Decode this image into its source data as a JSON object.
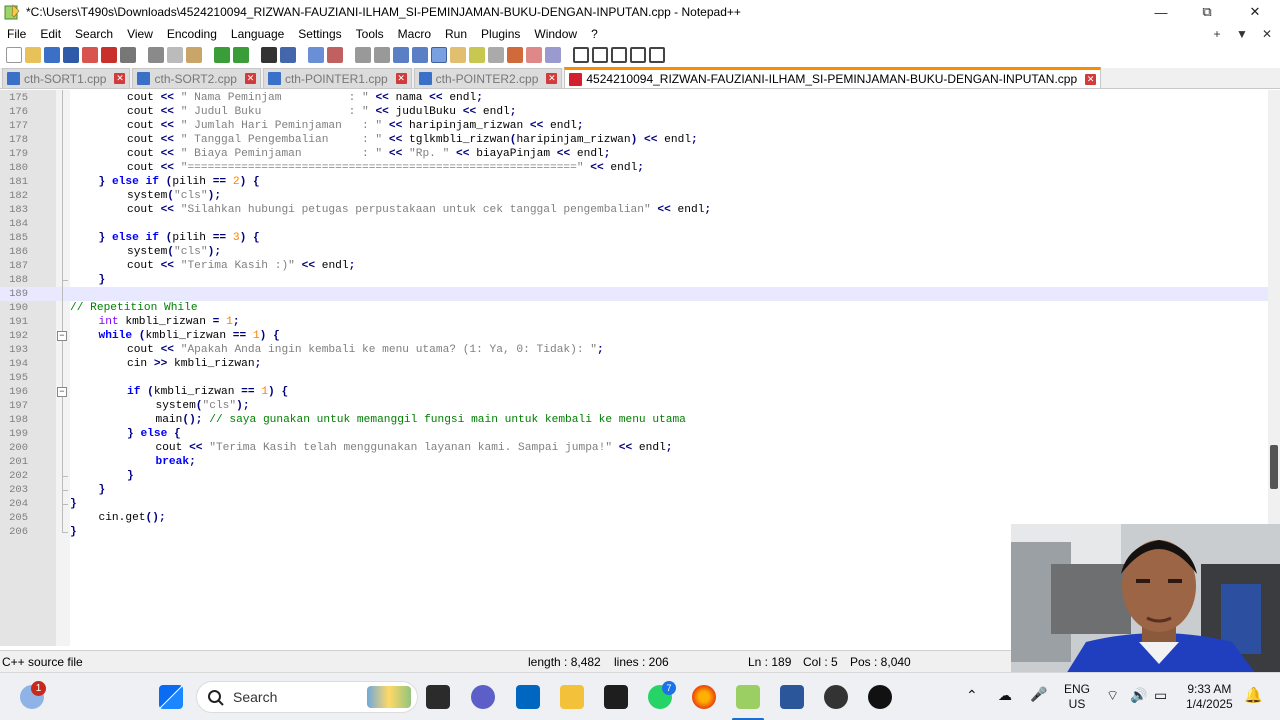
{
  "window": {
    "title": "*C:\\Users\\T490s\\Downloads\\4524210094_RIZWAN-FAUZIANI-ILHAM_SI-PEMINJAMAN-BUKU-DENGAN-INPUTAN.cpp - Notepad++",
    "app_icon": "notepadpp-icon",
    "controls": [
      "minimize-icon",
      "restore-icon",
      "close-icon"
    ]
  },
  "menu": {
    "items": [
      "File",
      "Edit",
      "Search",
      "View",
      "Encoding",
      "Language",
      "Settings",
      "Tools",
      "Macro",
      "Run",
      "Plugins",
      "Window",
      "?"
    ],
    "right_controls": [
      "+",
      "▼",
      "✕"
    ]
  },
  "toolbar": {
    "buttons": [
      "new-file-icon",
      "open-file-icon",
      "save-icon",
      "save-all-icon",
      "close-icon",
      "close-all-icon",
      "print-icon",
      "cut-icon",
      "copy-icon",
      "paste-icon",
      "undo-icon",
      "redo-icon",
      "find-icon",
      "replace-icon",
      "zoom-in-icon",
      "zoom-out-icon",
      "sync-vertical-icon",
      "sync-horizontal-icon",
      "word-wrap-icon",
      "show-all-chars-icon",
      "indent-guide-icon",
      "user-language-icon",
      "document-map-icon",
      "function-list-icon",
      "folder-workspace-icon",
      "monitoring-icon",
      "record-macro-icon",
      "stop-record-icon",
      "play-macro-icon",
      "run-macro-multiple-icon",
      "save-macro-icon"
    ]
  },
  "tabs": [
    {
      "label": "cth-SORT1.cpp",
      "active": false
    },
    {
      "label": "cth-SORT2.cpp",
      "active": false
    },
    {
      "label": "cth-POINTER1.cpp",
      "active": false
    },
    {
      "label": "cth-POINTER2.cpp",
      "active": false
    },
    {
      "label": "4524210094_RIZWAN-FAUZIANI-ILHAM_SI-PEMINJAMAN-BUKU-DENGAN-INPUTAN.cpp",
      "active": true
    }
  ],
  "editor": {
    "current_line": 189,
    "lines": [
      {
        "n": "175",
        "indent": 2,
        "code": "cout << \" Nama Peminjam          : \" << nama << endl;"
      },
      {
        "n": "176",
        "indent": 2,
        "code": "cout << \" Judul Buku             : \" << judulBuku << endl;"
      },
      {
        "n": "177",
        "indent": 2,
        "code": "cout << \" Jumlah Hari Peminjaman   : \" << haripinjam_rizwan << endl;"
      },
      {
        "n": "178",
        "indent": 2,
        "code": "cout << \" Tanggal Pengembalian     : \" << tglkmbli_rizwan(haripinjam_rizwan) << endl;"
      },
      {
        "n": "179",
        "indent": 2,
        "code": "cout << \" Biaya Peminjaman         : \" << \"Rp. \" << biayaPinjam << endl;"
      },
      {
        "n": "180",
        "indent": 2,
        "code": "cout << \"==========================================================\" << endl;"
      },
      {
        "n": "181",
        "indent": 1,
        "code": "} else if (pilih == 2) {"
      },
      {
        "n": "182",
        "indent": 2,
        "code": "system(\"cls\");"
      },
      {
        "n": "183",
        "indent": 2,
        "code": "cout << \"Silahkan hubungi petugas perpustakaan untuk cek tanggal pengembalian\" << endl;"
      },
      {
        "n": "184",
        "indent": 0,
        "code": ""
      },
      {
        "n": "185",
        "indent": 1,
        "code": "} else if (pilih == 3) {"
      },
      {
        "n": "186",
        "indent": 2,
        "code": "system(\"cls\");"
      },
      {
        "n": "187",
        "indent": 2,
        "code": "cout << \"Terima Kasih :)\" << endl;"
      },
      {
        "n": "188",
        "indent": 1,
        "code": "}"
      },
      {
        "n": "189",
        "indent": 0,
        "code": ""
      },
      {
        "n": "190",
        "indent": 0,
        "code": "// Repetition While"
      },
      {
        "n": "191",
        "indent": 1,
        "code": "int kmbli_rizwan = 1;"
      },
      {
        "n": "192",
        "indent": 1,
        "code": "while (kmbli_rizwan == 1) {"
      },
      {
        "n": "193",
        "indent": 2,
        "code": "cout << \"Apakah Anda ingin kembali ke menu utama? (1: Ya, 0: Tidak): \";"
      },
      {
        "n": "194",
        "indent": 2,
        "code": "cin >> kmbli_rizwan;"
      },
      {
        "n": "195",
        "indent": 0,
        "code": ""
      },
      {
        "n": "196",
        "indent": 2,
        "code": "if (kmbli_rizwan == 1) {"
      },
      {
        "n": "197",
        "indent": 3,
        "code": "system(\"cls\");"
      },
      {
        "n": "198",
        "indent": 3,
        "code": "main(); // saya gunakan untuk memanggil fungsi main untuk kembali ke menu utama"
      },
      {
        "n": "199",
        "indent": 2,
        "code": "} else {"
      },
      {
        "n": "200",
        "indent": 3,
        "code": "cout << \"Terima Kasih telah menggunakan layanan kami. Sampai jumpa!\" << endl;"
      },
      {
        "n": "201",
        "indent": 3,
        "code": "break;"
      },
      {
        "n": "202",
        "indent": 2,
        "code": "}"
      },
      {
        "n": "203",
        "indent": 1,
        "code": "}"
      },
      {
        "n": "204",
        "indent": 0,
        "code": "}"
      },
      {
        "n": "205",
        "indent": 1,
        "code": "cin.get();"
      },
      {
        "n": "206",
        "indent": 0,
        "code": "}"
      }
    ]
  },
  "scrollbar": {
    "thumb_position": 0.85
  },
  "statusbar": {
    "filetype": "C++ source file",
    "length": "length : 8,482",
    "lines": "lines : 206",
    "ln": "Ln : 189",
    "col": "Col : 5",
    "pos": "Pos : 8,040"
  },
  "taskbar": {
    "weather_badge": "1",
    "search_label": "Search",
    "whatsapp_badge": "7",
    "language": "ENG",
    "region": "US",
    "time": "9:33 AM",
    "date": "1/4/2025"
  }
}
